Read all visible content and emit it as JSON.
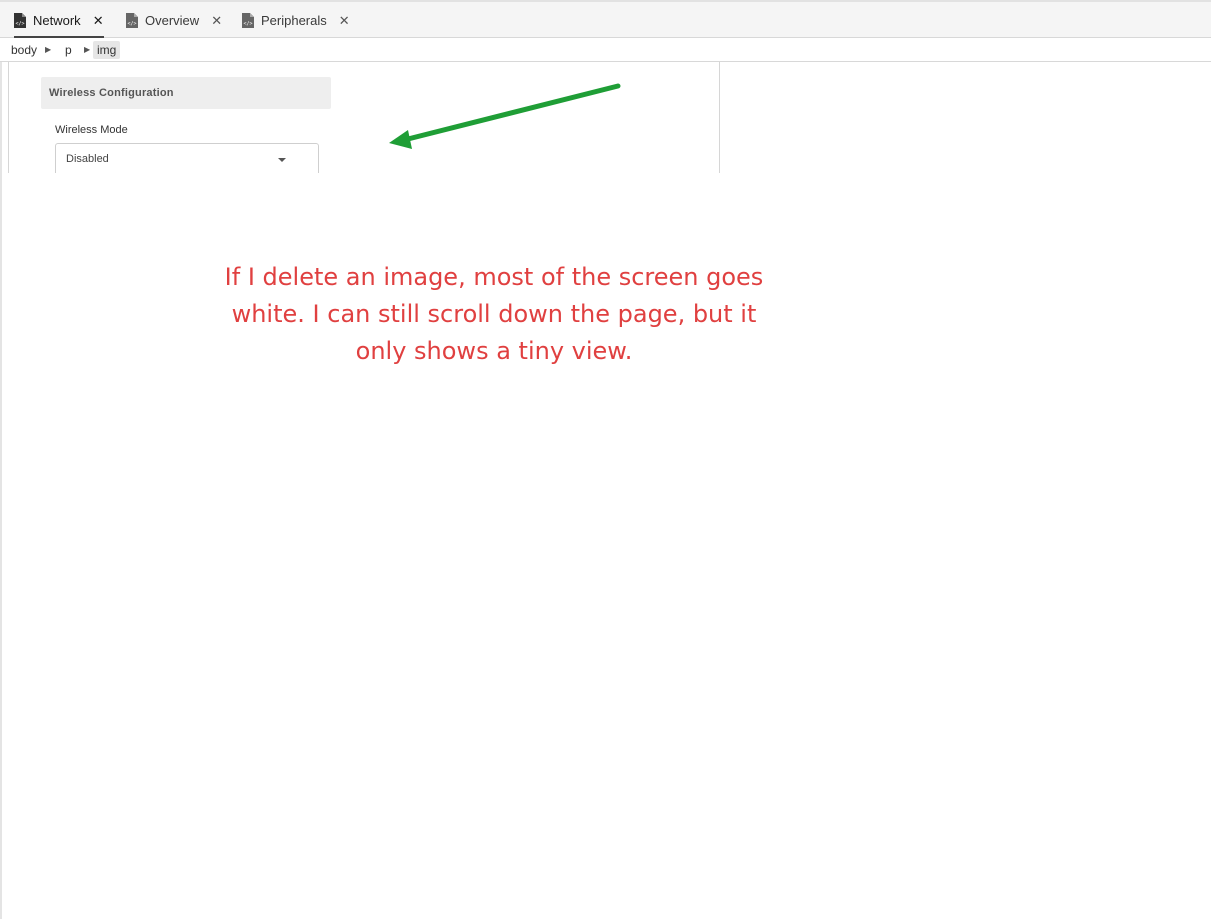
{
  "tabs": [
    {
      "label": "Network",
      "icon": "document-code-icon",
      "active": true,
      "close": "✕"
    },
    {
      "label": "Overview",
      "icon": "document-code-icon",
      "active": false,
      "close": "✕"
    },
    {
      "label": "Peripherals",
      "icon": "document-code-icon",
      "active": false,
      "close": "✕"
    }
  ],
  "breadcrumb": {
    "items": [
      "body",
      "p",
      "img"
    ],
    "separator": "▶",
    "selected": "img"
  },
  "preview": {
    "section_title": "Wireless Configuration",
    "field_label": "Wireless Mode",
    "field_value": "Disabled"
  },
  "annotation": {
    "text": "If I delete an image, most of the screen goes white. I can still scroll down the page, but it only shows a tiny view.",
    "text_color": "#e04040",
    "arrow_color": "#1f9e36"
  }
}
